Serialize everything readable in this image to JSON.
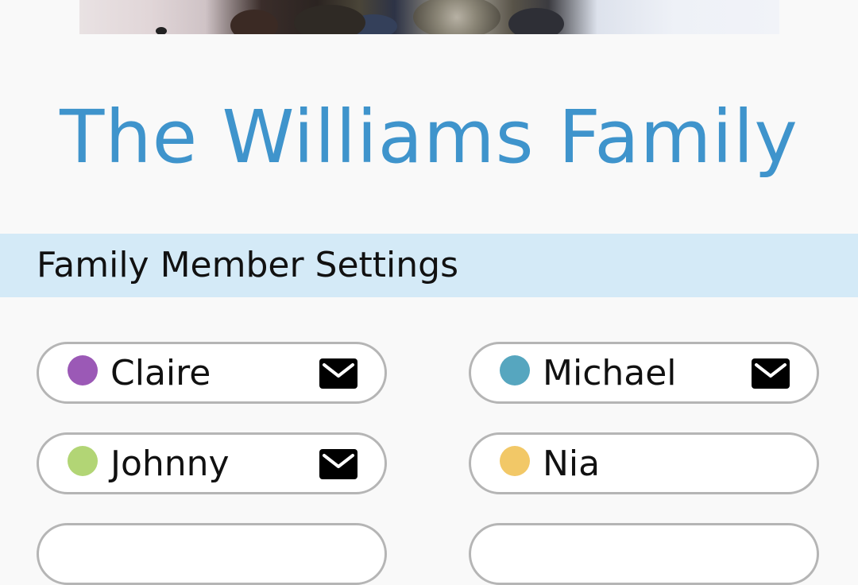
{
  "family": {
    "title": "The Williams Family"
  },
  "section": {
    "title": "Family Member Settings"
  },
  "members": [
    {
      "name": "Claire",
      "color": "#9b59b6",
      "has_email": true
    },
    {
      "name": "Michael",
      "color": "#56a6bf",
      "has_email": true
    },
    {
      "name": "Johnny",
      "color": "#b2d575",
      "has_email": true
    },
    {
      "name": "Nia",
      "color": "#f2c867",
      "has_email": false
    }
  ],
  "icons": {
    "email": "envelope-icon"
  }
}
